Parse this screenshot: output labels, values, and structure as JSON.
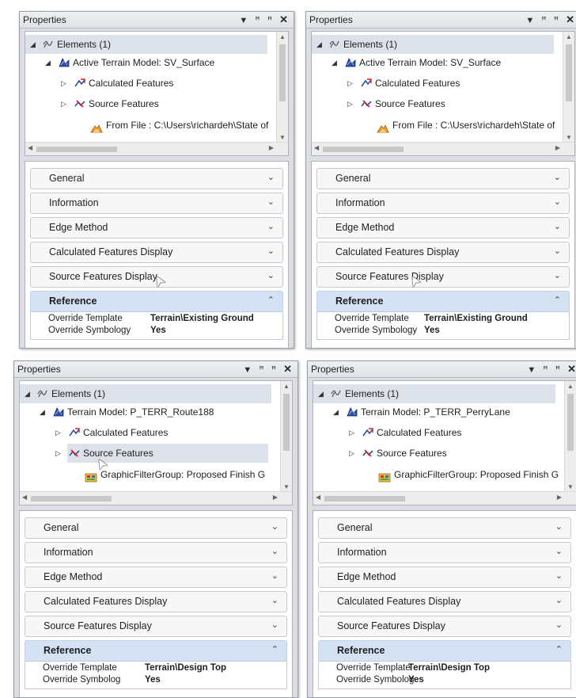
{
  "colors": {
    "selection": "#dde1ea",
    "reference_header": "#d4e2f4",
    "panel_bg": "#dcdee3"
  },
  "panels": [
    {
      "title": "Properties",
      "window_icons": {
        "menu": "▼",
        "autohide": "⊥",
        "float": "⊥",
        "close": "✕"
      },
      "tree": {
        "root": "Elements (1)",
        "model": "Active Terrain Model: SV_Surface",
        "calculated": "Calculated Features",
        "source": "Source Features",
        "last": "From File : C:\\Users\\richardeh\\State of"
      },
      "sections": {
        "general": "General",
        "information": "Information",
        "edge_method": "Edge Method",
        "calculated_display": "Calculated Features Display",
        "source_display": "Source Features Display",
        "reference": "Reference"
      },
      "reference": {
        "template_label": "Override Template",
        "template_value": "Terrain\\Existing Ground",
        "symbology_label": "Override Symbology",
        "symbology_value": "Yes"
      }
    },
    {
      "title": "Properties",
      "window_icons": {
        "menu": "▼",
        "autohide": "⊥",
        "float": "⊥",
        "close": "✕"
      },
      "tree": {
        "root": "Elements (1)",
        "model": "Active Terrain Model: SV_Surface",
        "calculated": "Calculated Features",
        "source": "Source Features",
        "last": "From File : C:\\Users\\richardeh\\State of"
      },
      "sections": {
        "general": "General",
        "information": "Information",
        "edge_method": "Edge Method",
        "calculated_display": "Calculated Features Display",
        "source_display": "Source Features Display",
        "reference": "Reference"
      },
      "reference": {
        "template_label": "Override Template",
        "template_value": "Terrain\\Existing Ground",
        "symbology_label": "Override Symbology",
        "symbology_value": "Yes"
      }
    },
    {
      "title": "Properties",
      "window_icons": {
        "menu": "▼",
        "autohide": "⊥",
        "float": "⊥",
        "close": "✕"
      },
      "tree": {
        "root": "Elements (1)",
        "model": "Terrain Model: P_TERR_Route188",
        "calculated": "Calculated Features",
        "source": "Source Features",
        "last": "GraphicFilterGroup: Proposed Finish G"
      },
      "sections": {
        "general": "General",
        "information": "Information",
        "edge_method": "Edge Method",
        "calculated_display": "Calculated Features Display",
        "source_display": "Source Features Display",
        "reference": "Reference"
      },
      "reference": {
        "template_label": "Override Template",
        "template_value": "Terrain\\Design Top",
        "symbology_label": "Override Symbolog",
        "symbology_value": "Yes"
      }
    },
    {
      "title": "Properties",
      "window_icons": {
        "menu": "▼",
        "autohide": "⊥",
        "float": "⊥",
        "close": "✕"
      },
      "tree": {
        "root": "Elements (1)",
        "model": "Terrain Model: P_TERR_PerryLane",
        "calculated": "Calculated Features",
        "source": "Source Features",
        "last": "GraphicFilterGroup: Proposed Finish G"
      },
      "sections": {
        "general": "General",
        "information": "Information",
        "edge_method": "Edge Method",
        "calculated_display": "Calculated Features Display",
        "source_display": "Source Features Display",
        "reference": "Reference"
      },
      "reference": {
        "template_label": "Override Template",
        "template_value": "Terrain\\Design Top",
        "symbology_label": "Override Symbolog",
        "symbology_value": "Yes"
      }
    }
  ]
}
